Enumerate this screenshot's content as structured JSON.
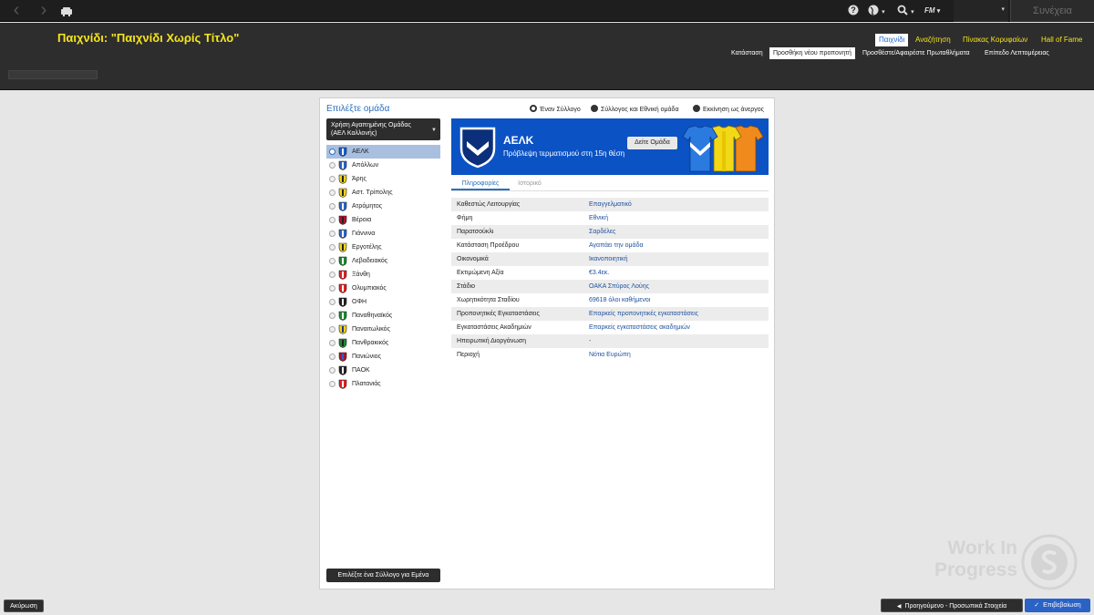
{
  "topbar": {
    "back_icon": "chevron-left-icon",
    "forward_icon": "chevron-right-icon",
    "home_icon": "home-icon",
    "help_icon": "help-icon",
    "globe_icon": "globe-icon",
    "search_icon": "search-icon",
    "fm_label": "FM",
    "continue_label": "Συνέχεια"
  },
  "header": {
    "title": "Παιχνίδι: \"Παιχνίδι Χωρίς Τίτλο\"",
    "nav": [
      {
        "label": "Παιχνίδι",
        "active": true
      },
      {
        "label": "Αναζήτηση",
        "active": false
      },
      {
        "label": "Πίνακας Κορυφαίων",
        "active": false
      },
      {
        "label": "Hall of Fame",
        "active": false
      }
    ],
    "subnav": [
      {
        "label": "Κατάσταση",
        "active": false
      },
      {
        "label": "Προσθήκη νέου προπονητή",
        "active": true
      },
      {
        "label": "Προσθέστε/Αφαιρέστε Πρωταθλήματα",
        "active": false
      },
      {
        "label": "Επίπεδο Λεπτομέρειας",
        "active": false
      }
    ]
  },
  "panel": {
    "title": "Επιλέξτε ομάδα",
    "radios": [
      {
        "label": "Έναν Σύλλογο",
        "selected": true
      },
      {
        "label": "Σύλλογος και Εθνική ομάδα",
        "selected": false
      },
      {
        "label": "Εκκίνηση ως άνεργος",
        "selected": false
      }
    ],
    "fav_dropdown": {
      "line1": "Χρήση Αγαπημένης Ομάδας",
      "line2": "(ΑΕΛ Καλλονής)"
    },
    "teams": [
      {
        "name": "ΑΕΛΚ",
        "selected": true,
        "c1": "#1560c8",
        "c2": "#ffffff"
      },
      {
        "name": "Απόλλων",
        "selected": false,
        "c1": "#2a64c5",
        "c2": "#ffffff"
      },
      {
        "name": "Άρης",
        "selected": false,
        "c1": "#f3d21a",
        "c2": "#222222"
      },
      {
        "name": "Αστ. Τρίπολης",
        "selected": false,
        "c1": "#f3d21a",
        "c2": "#222222"
      },
      {
        "name": "Ατρόμητος",
        "selected": false,
        "c1": "#2a64c5",
        "c2": "#ffffff"
      },
      {
        "name": "Βέροια",
        "selected": false,
        "c1": "#b3122c",
        "c2": "#222222"
      },
      {
        "name": "Γιάννινα",
        "selected": false,
        "c1": "#2a64c5",
        "c2": "#ffffff"
      },
      {
        "name": "Εργοτέλης",
        "selected": false,
        "c1": "#f3d21a",
        "c2": "#222222"
      },
      {
        "name": "Λεβαδειακός",
        "selected": false,
        "c1": "#1c8a2e",
        "c2": "#ffffff"
      },
      {
        "name": "Ξάνθη",
        "selected": false,
        "c1": "#e02020",
        "c2": "#ffffff"
      },
      {
        "name": "Ολυμπιακός",
        "selected": false,
        "c1": "#e02020",
        "c2": "#ffffff"
      },
      {
        "name": "ΟΦΗ",
        "selected": false,
        "c1": "#222222",
        "c2": "#ffffff"
      },
      {
        "name": "Παναθηναϊκός",
        "selected": false,
        "c1": "#1c8a2e",
        "c2": "#ffffff"
      },
      {
        "name": "Παναιτωλικός",
        "selected": false,
        "c1": "#f3d21a",
        "c2": "#1a3a8a"
      },
      {
        "name": "Πανθρακικός",
        "selected": false,
        "c1": "#1c8a2e",
        "c2": "#222222"
      },
      {
        "name": "Πανιώνιος",
        "selected": false,
        "c1": "#b3122c",
        "c2": "#2a64c5"
      },
      {
        "name": "ΠΑΟΚ",
        "selected": false,
        "c1": "#222222",
        "c2": "#ffffff"
      },
      {
        "name": "Πλατανιάς",
        "selected": false,
        "c1": "#e02020",
        "c2": "#ffffff"
      }
    ],
    "random_button": "Επιλέξτε ένα Σύλλογο για Εμένα",
    "banner": {
      "name": "ΑΕΛΚ",
      "prediction": "Πρόβλεψη τερματισμού στη 15η θέση",
      "view_button": "Δείτε Ομάδα",
      "color": "#0b52c4"
    },
    "tabs": [
      {
        "label": "Πληροφορίες",
        "active": true
      },
      {
        "label": "Ιστορικό",
        "active": false
      }
    ],
    "info": [
      {
        "key": "Καθεστώς Λειτουργίας",
        "value": "Επαγγελματικό"
      },
      {
        "key": "Φήμη",
        "value": "Εθνική"
      },
      {
        "key": "Παρατσούκλι",
        "value": "Σαρδέλες"
      },
      {
        "key": "Κατάσταση Προέδρου",
        "value": "Αγαπάει την ομάδα"
      },
      {
        "key": "Οικονομικά",
        "value": "Ικανοποιητική"
      },
      {
        "key": "Εκτιμώμενη Αξία",
        "value": "€3.4εκ."
      },
      {
        "key": "Στάδιο",
        "value": "ΟΑΚΑ Σπύρος Λούης"
      },
      {
        "key": "Χωρητικότητα Σταδίου",
        "value": "69618 όλοι καθήμενοι"
      },
      {
        "key": "Προπονητικές Εγκαταστάσεις",
        "value": "Επαρκείς προπονητικές εγκαταστάσεις"
      },
      {
        "key": "Εγκαταστάσεις Ακαδημιών",
        "value": "Επαρκείς εγκαταστάσεις ακαδημιών"
      },
      {
        "key": "Ηπειρωτική Διοργάνωση",
        "value": "-"
      },
      {
        "key": "Περιοχή",
        "value": "Νότια Ευρώπη"
      }
    ]
  },
  "footer": {
    "cancel": "Ακύρωση",
    "previous": "Προηγούμενο - Προσωπικά Στοιχεία",
    "confirm": "Επιβεβαίωση"
  },
  "watermark": {
    "line1": "Work In",
    "line2": "Progress",
    "logo_icon": "sports-interactive-logo"
  },
  "colors": {
    "accent": "#f5e51c",
    "link": "#1d4f9e",
    "selection": "#a8bfe0",
    "confirm": "#2a62c6"
  }
}
